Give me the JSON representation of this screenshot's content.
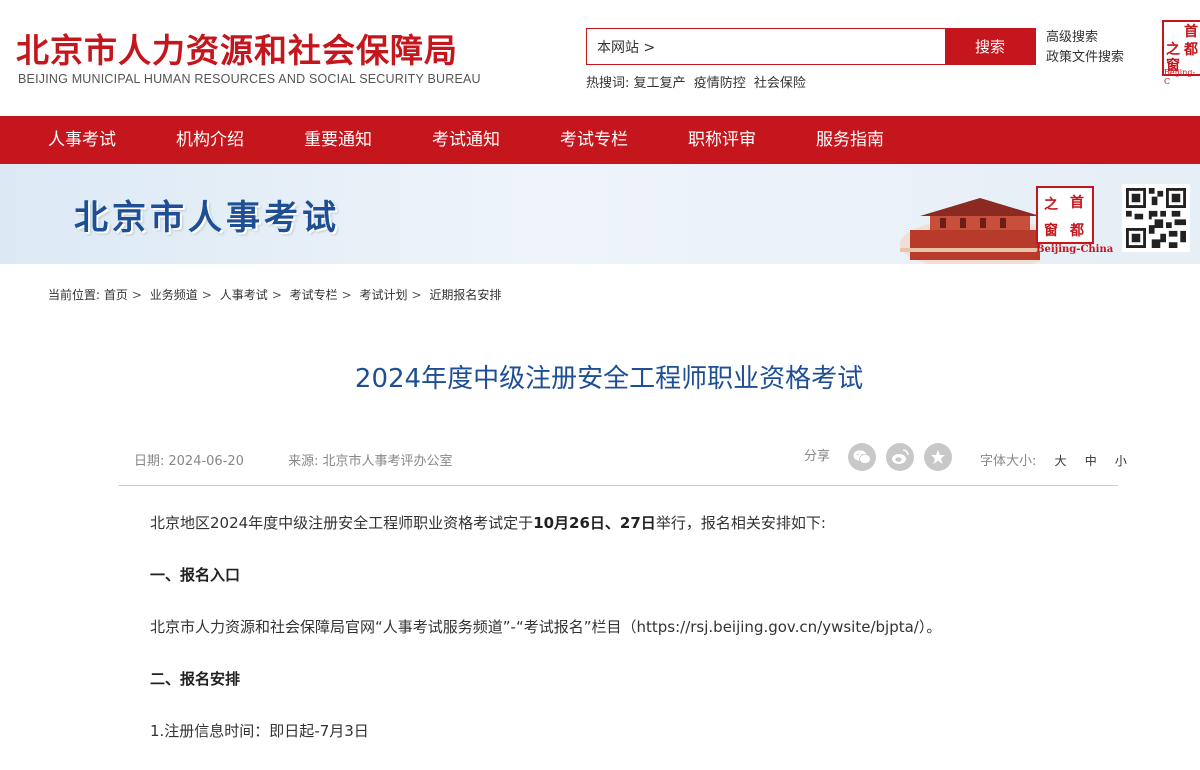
{
  "header": {
    "title": "北京市人力资源和社会保障局",
    "subtitle": "BEIJING MUNICIPAL HUMAN RESOURCES AND SOCIAL SECURITY BUREAU",
    "search": {
      "value": "本网站 >",
      "button": "搜索"
    },
    "advanced_search": "高级搜索",
    "policy_search": "政策文件搜索",
    "hot": {
      "label": "热搜词:",
      "words": [
        "复工复产",
        "疫情防控",
        "社会保险"
      ]
    },
    "seal": {
      "top_left": "之",
      "top_right": "首",
      "bottom_left": "窗",
      "bottom_right": "都",
      "caption": "Beijing-C"
    }
  },
  "nav": [
    "人事考试",
    "机构介绍",
    "重要通知",
    "考试通知",
    "考试专栏",
    "职称评审",
    "服务指南"
  ],
  "banner": {
    "title": "北京市人事考试",
    "seal": {
      "tl": "之",
      "tr": "首",
      "bl": "窗",
      "br": "都"
    },
    "seal_caption": "Beijing-China"
  },
  "breadcrumb": {
    "label": "当前位置:",
    "items": [
      "首页",
      "业务频道",
      "人事考试",
      "考试专栏",
      "考试计划",
      "近期报名安排"
    ]
  },
  "article": {
    "title": "2024年度中级注册安全工程师职业资格考试",
    "date_label": "日期:",
    "date": "2024-06-20",
    "source_label": "来源:",
    "source": "北京市人事考评办公室",
    "share_label": "分享",
    "font_label": "字体大小:",
    "font_sizes": [
      "大",
      "中",
      "小"
    ],
    "p1_a": "北京地区2024年度中级注册安全工程师职业资格考试定于",
    "p1_b": "10月26日、27日",
    "p1_c": "举行，报名相关安排如下:",
    "h1": "一、报名入口",
    "p2": "北京市人力资源和社会保障局官网“人事考试服务频道”-“考试报名”栏目（https://rsj.beijing.gov.cn/ywsite/bjpta/）。",
    "h2": "二、报名安排",
    "p3": "1.注册信息时间：即日起-7月3日"
  },
  "colors": {
    "brand_red": "#c4161c",
    "title_blue": "#1e4f95"
  }
}
